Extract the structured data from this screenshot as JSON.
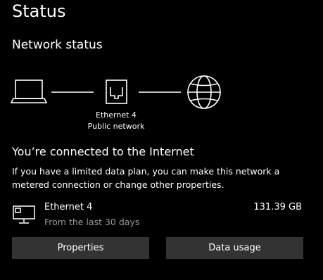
{
  "page": {
    "title": "Status"
  },
  "network_status": {
    "heading": "Network status",
    "diagram": {
      "device_icon": "laptop-icon",
      "adapter_icon": "ethernet-port-icon",
      "internet_icon": "globe-icon",
      "adapter_name": "Ethernet 4",
      "network_profile": "Public network"
    },
    "connected_heading": "You’re connected to the Internet",
    "connected_description": "If you have a limited data plan, you can make this network a metered connection or change other properties."
  },
  "usage": {
    "icon": "ethernet-computer-icon",
    "adapter_name": "Ethernet 4",
    "period": "From the last 30 days",
    "amount": "131.39 GB"
  },
  "buttons": {
    "properties": "Properties",
    "data_usage": "Data usage"
  },
  "colors": {
    "background": "#000000",
    "text": "#ffffff",
    "secondary_text": "#9a9a9a",
    "button_background": "#333333"
  }
}
